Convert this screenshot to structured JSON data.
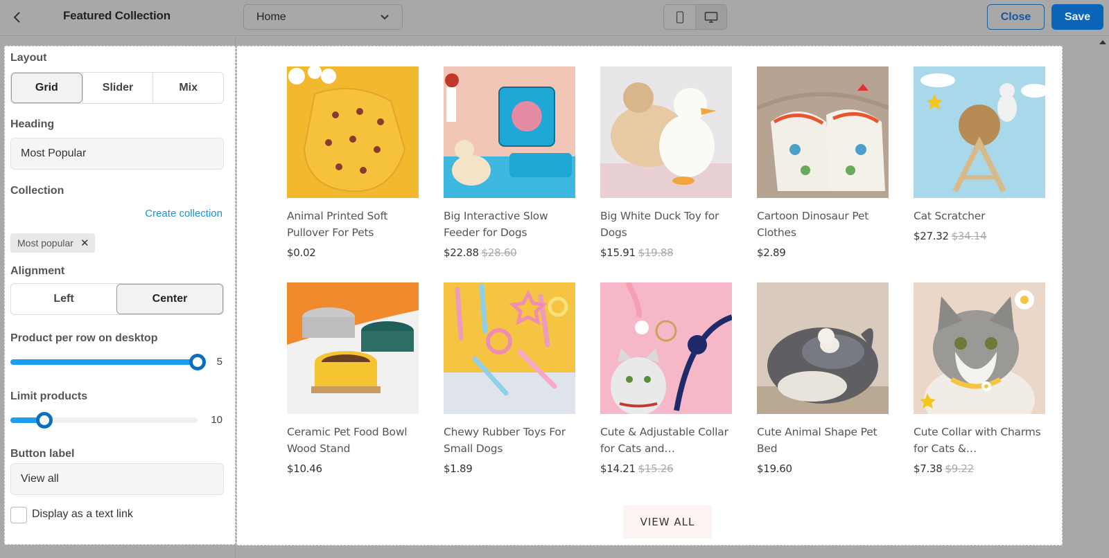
{
  "header": {
    "title": "Featured Collection",
    "page_select": "Home",
    "close_label": "Close",
    "save_label": "Save"
  },
  "sidebar": {
    "layout_label": "Layout",
    "layout_options": [
      "Grid",
      "Slider",
      "Mix"
    ],
    "layout_selected": "Grid",
    "heading_label": "Heading",
    "heading_value": "Most Popular",
    "collection_label": "Collection",
    "create_collection": "Create collection",
    "collection_chip": "Most popular",
    "alignment_label": "Alignment",
    "alignment_options": [
      "Left",
      "Center"
    ],
    "alignment_selected": "Center",
    "per_row_label": "Product per row on desktop",
    "per_row_value": "5",
    "per_row_fraction": 1.0,
    "limit_label": "Limit products",
    "limit_value": "10",
    "limit_fraction": 0.18,
    "button_label_label": "Button label",
    "button_label_value": "View all",
    "text_link_label": "Display as a text link",
    "text_link_checked": false
  },
  "products": [
    {
      "name": "Animal Printed Soft Pullover For Pets",
      "price": "$0.02",
      "old": ""
    },
    {
      "name": "Big Interactive Slow Feeder for Dogs",
      "price": "$22.88",
      "old": "$28.60"
    },
    {
      "name": "Big White Duck Toy for Dogs",
      "price": "$15.91",
      "old": "$19.88"
    },
    {
      "name": "Cartoon Dinosaur Pet Clothes",
      "price": "$2.89",
      "old": ""
    },
    {
      "name": "Cat Scratcher",
      "price": "$27.32",
      "old": "$34.14"
    },
    {
      "name": "Ceramic Pet Food Bowl Wood Stand",
      "price": "$10.46",
      "old": ""
    },
    {
      "name": "Chewy Rubber Toys For Small Dogs",
      "price": "$1.89",
      "old": ""
    },
    {
      "name": "Cute & Adjustable Collar for Cats and…",
      "price": "$14.21",
      "old": "$15.26"
    },
    {
      "name": "Cute Animal Shape Pet Bed",
      "price": "$19.60",
      "old": ""
    },
    {
      "name": "Cute Collar with Charms for Cats &…",
      "price": "$7.38",
      "old": "$9.22"
    }
  ],
  "preview": {
    "view_all": "VIEW ALL"
  },
  "colors": {
    "accent": "#0a65b8",
    "slider": "#1b9ef0",
    "link": "#1b8fd8"
  }
}
